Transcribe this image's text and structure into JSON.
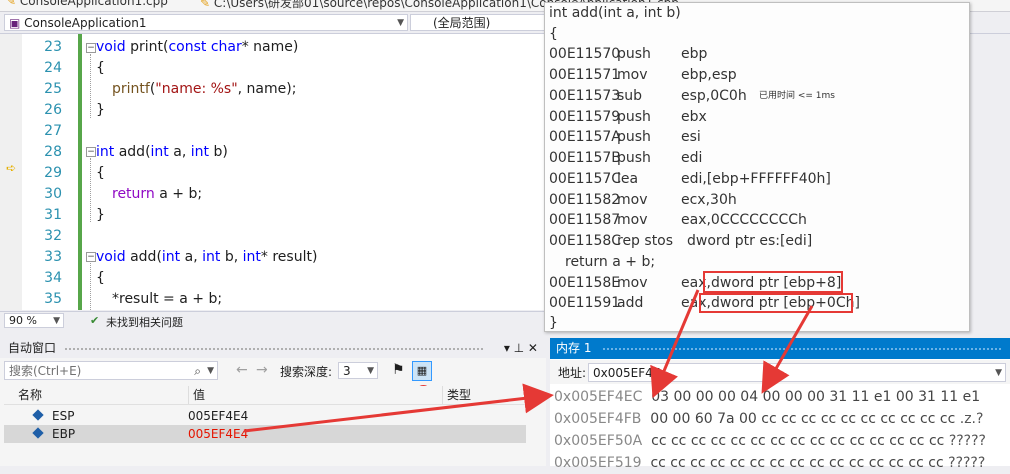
{
  "topbar": {
    "tab_file": "ConsoleApplication1.cpp",
    "tab_path": "C:\\Users\\研发部01\\source\\repos\\ConsoleApplication1\\ConsoleApplication1.cpp"
  },
  "navbar": {
    "project": "ConsoleApplication1",
    "scope": "(全局范围)"
  },
  "editor": {
    "line_numbers": [
      "23",
      "24",
      "25",
      "26",
      "27",
      "28",
      "29",
      "30",
      "31",
      "32",
      "33",
      "34",
      "35"
    ],
    "zoom": "90 %",
    "status": "未找到相关问题"
  },
  "code": {
    "l23_kw": "void",
    "l23_rest": " print(",
    "l23_kw2": "const",
    "l23_kw3": " char",
    "l23_rest2": "* name)",
    "l24": "{",
    "l25_fn": "printf",
    "l25_open": "(",
    "l25_str": "\"name: %s\"",
    "l25_rest": ", name);",
    "l26": "}",
    "l28_kw": "int",
    "l28_rest": " add(",
    "l28_kw2": "int",
    "l28_rest2": " a, ",
    "l28_kw3": "int",
    "l28_rest3": " b)",
    "l29": "{",
    "l30_kw": "return",
    "l30_rest": " a + b;",
    "l31": "}",
    "l33_kw": "void",
    "l33_rest": " add(",
    "l33_kw2": "int",
    "l33_rest2": " a, ",
    "l33_kw3": "int",
    "l33_rest3": " b, ",
    "l33_kw4": "int",
    "l33_rest4": "* result)",
    "l34": "{",
    "l35": "*result = a + b;"
  },
  "disasm": {
    "header": "int add(int a, int b)",
    "open_brace": "{",
    "rows": [
      {
        "addr": "00E11570",
        "op": "push",
        "arg": "ebp"
      },
      {
        "addr": "00E11571",
        "op": "mov",
        "arg": "ebp,esp"
      },
      {
        "addr": "00E11573",
        "op": "sub",
        "arg": "esp,0C0h"
      },
      {
        "addr": "00E11579",
        "op": "push",
        "arg": "ebx"
      },
      {
        "addr": "00E1157A",
        "op": "push",
        "arg": "esi"
      },
      {
        "addr": "00E1157B",
        "op": "push",
        "arg": "edi"
      },
      {
        "addr": "00E1157C",
        "op": "lea",
        "arg": "edi,[ebp+FFFFFF40h]"
      },
      {
        "addr": "00E11582",
        "op": "mov",
        "arg": "ecx,30h"
      },
      {
        "addr": "00E11587",
        "op": "mov",
        "arg": "eax,0CCCCCCCCh"
      },
      {
        "addr": "00E1158C",
        "op": "rep stos",
        "arg": "dword ptr es:[edi]"
      }
    ],
    "elapsed": "已用时间 <= 1ms",
    "source_line": "return a + b;",
    "rows2": [
      {
        "addr": "00E1158E",
        "op": "mov",
        "reg": "eax,",
        "arg": "dword ptr [ebp+8]"
      },
      {
        "addr": "00E11591",
        "op": "add",
        "reg": "eax,",
        "arg": "dword ptr [ebp+0Ch]"
      }
    ],
    "close_brace": "}"
  },
  "autos": {
    "title": "自动窗口",
    "pin": "▾ ⊥ ✕",
    "search_placeholder": "搜索(Ctrl+E)",
    "depth_label": "搜索深度:",
    "depth_value": "3",
    "col_name": "名称",
    "col_value": "值",
    "col_type": "类型",
    "rows": [
      {
        "name": "ESP",
        "value": "005EF4E4",
        "changed": false
      },
      {
        "name": "EBP",
        "value": "005EF4E4",
        "changed": true
      }
    ]
  },
  "memory": {
    "title": "内存 1",
    "addr_label": "地址:",
    "addr_value": "0x005EF4E",
    "lines": [
      {
        "addr": "0x005EF4EC",
        "hex": "03 00 00 00 04 00 00 00 31 11 e1 00 31 11 e1"
      },
      {
        "addr": "0x005EF4FB",
        "hex": "00 00 60 7a 00 cc cc cc cc cc cc cc cc cc cc",
        "ascii": ".z.?"
      },
      {
        "addr": "0x005EF50A",
        "hex": "cc cc cc cc cc cc cc cc cc cc cc cc cc cc cc",
        "ascii": "?????"
      },
      {
        "addr": "0x005EF519",
        "hex": "cc cc cc cc cc cc cc cc cc cc cc cc cc cc cc",
        "ascii": "?????"
      }
    ]
  },
  "annotation": {
    "plus8": "+8"
  },
  "colors": {
    "accent": "#007acc",
    "annotation_red": "#e53935",
    "changed_value": "#e51400"
  }
}
